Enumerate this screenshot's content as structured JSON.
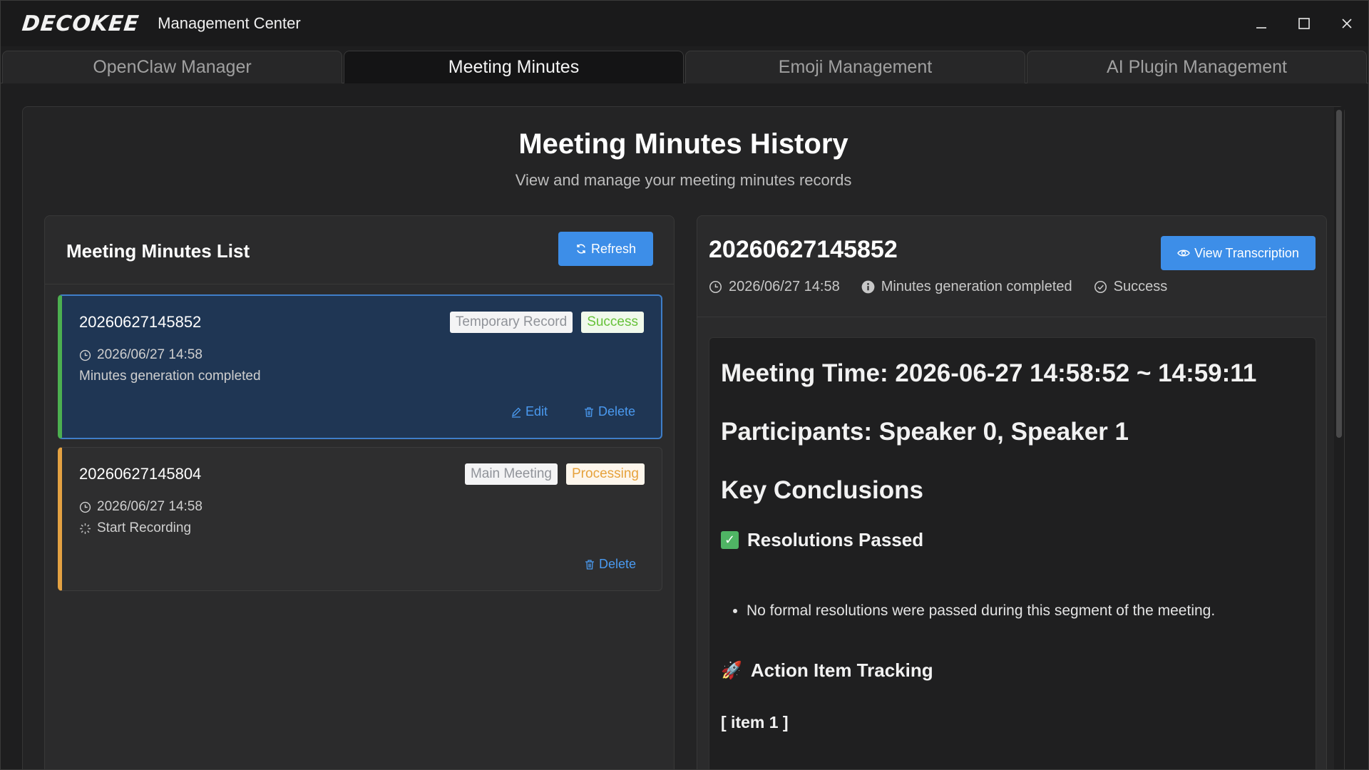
{
  "window": {
    "logo_text": "DECOKEE",
    "title": "Management Center",
    "controls": {
      "minimize": "_",
      "maximize": "☐",
      "close": "✕"
    }
  },
  "tabs": [
    {
      "label": "OpenClaw Manager",
      "active": false
    },
    {
      "label": "Meeting Minutes",
      "active": true
    },
    {
      "label": "Emoji Management",
      "active": false
    },
    {
      "label": "AI Plugin Management",
      "active": false
    }
  ],
  "page": {
    "title": "Meeting Minutes History",
    "subtitle": "View and manage your meeting minutes records"
  },
  "list_panel": {
    "title": "Meeting Minutes List",
    "refresh_label": "Refresh",
    "records": [
      {
        "id": "20260627145852",
        "type_badge": "Temporary Record",
        "status_badge": "Success",
        "time": "2026/06/27 14:58",
        "status_text": "Minutes generation completed",
        "edit_label": "Edit",
        "delete_label": "Delete"
      },
      {
        "id": "20260627145804",
        "type_badge": "Main Meeting",
        "status_badge": "Processing",
        "time": "2026/06/27 14:58",
        "status_text": "Start Recording",
        "delete_label": "Delete"
      }
    ]
  },
  "detail_panel": {
    "title": "20260627145852",
    "view_transcription_label": "View Transcription",
    "meta": {
      "time": "2026/06/27 14:58",
      "status_text": "Minutes generation completed",
      "result": "Success"
    },
    "content": {
      "meeting_time": "Meeting Time: 2026-06-27 14:58:52 ~ 14:59:11",
      "participants": "Participants: Speaker 0, Speaker 1",
      "key_conclusions": "Key Conclusions",
      "resolutions_heading": "Resolutions Passed",
      "resolutions": [
        "No formal resolutions were passed during this segment of the meeting."
      ],
      "action_heading": "Action Item Tracking",
      "item_label": "[ item 1 ]"
    }
  },
  "colors": {
    "accent": "#3d8ee8",
    "success": "#67c23a",
    "warning": "#e6a23c",
    "selected_bg": "#1f3654"
  }
}
